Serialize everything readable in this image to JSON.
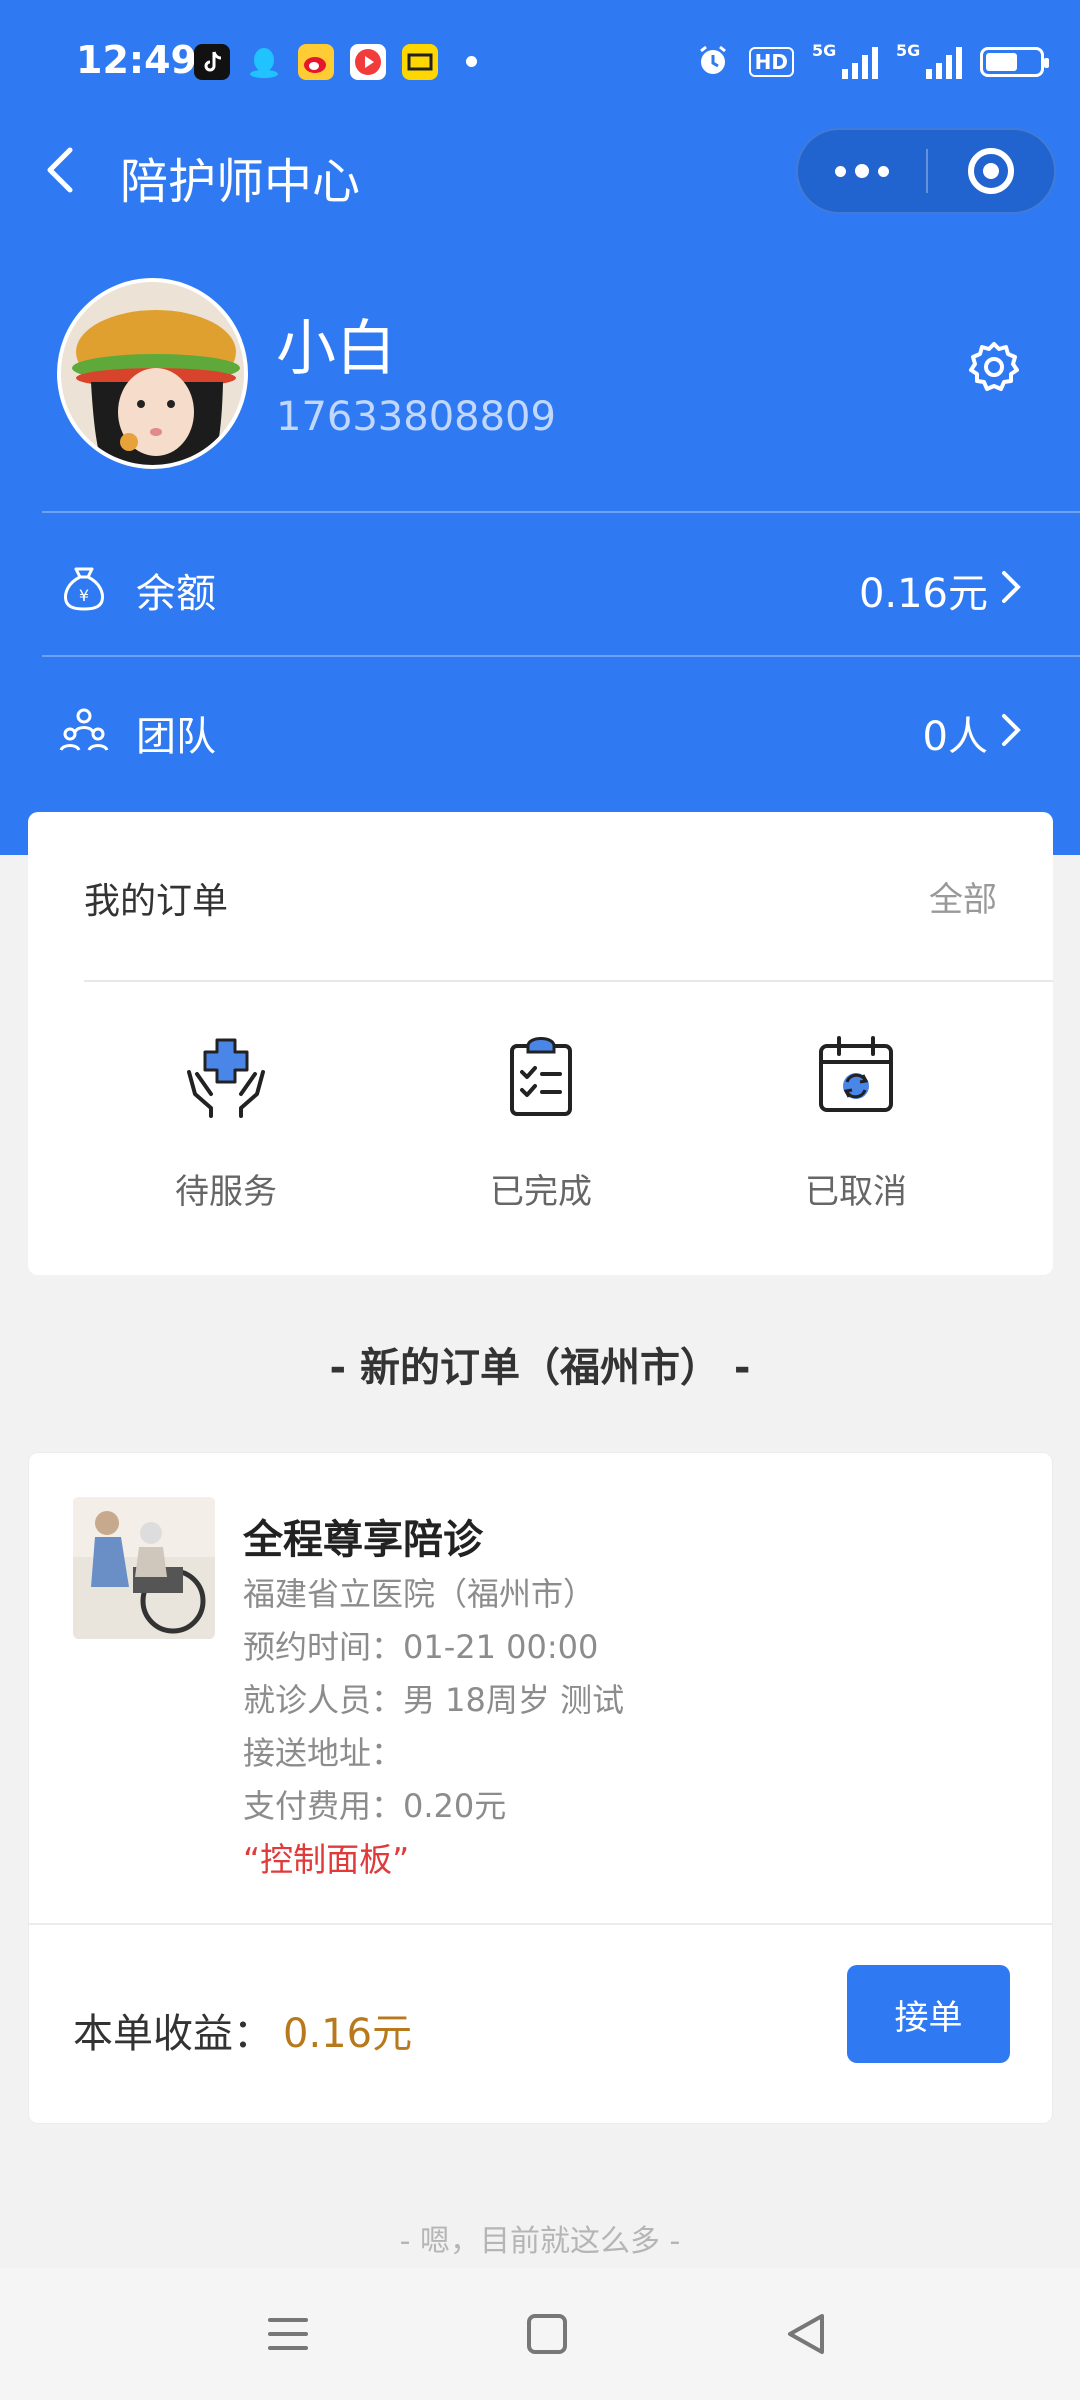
{
  "status_bar": {
    "time": "12:49",
    "hd_label": "HD",
    "signal_1_label": "5G",
    "signal_2_label": "5G",
    "battery_level": 0.6
  },
  "nav": {
    "title": "陪护师中心",
    "back_icon": "back-arrow-icon",
    "more_icon": "more-dots-icon",
    "close_icon": "target-close-icon"
  },
  "profile": {
    "name": "小白",
    "phone": "17633808809",
    "settings_icon": "gear-icon"
  },
  "balance": {
    "label": "余额",
    "value": "0.16元",
    "icon": "money-bag-icon"
  },
  "team": {
    "label": "团队",
    "value": "0人",
    "icon": "team-icon"
  },
  "my_orders": {
    "title": "我的订单",
    "all_label": "全部",
    "statuses": [
      {
        "label": "待服务",
        "icon": "care-hands-icon"
      },
      {
        "label": "已完成",
        "icon": "clipboard-check-icon"
      },
      {
        "label": "已取消",
        "icon": "calendar-refresh-icon"
      }
    ]
  },
  "new_orders_title": "- 新的订单（福州市） -",
  "order": {
    "name": "全程尊享陪诊",
    "hospital": "福建省立医院（福州市）",
    "appointment_time": "预约时间：01-21 00:00",
    "patient": "就诊人员：男 18周岁 测试",
    "pickup_address": "接送地址：",
    "payment": "支付费用：0.20元",
    "note": "“控制面板”",
    "income_label": "本单收益：",
    "income_value": "0.16元",
    "accept_label": "接单"
  },
  "footer_note": "- 嗯，目前就这么多 -",
  "colors": {
    "primary": "#2f7af2",
    "income": "#b8791c",
    "note_red": "#e03a3a",
    "background": "#f2f2f2"
  }
}
